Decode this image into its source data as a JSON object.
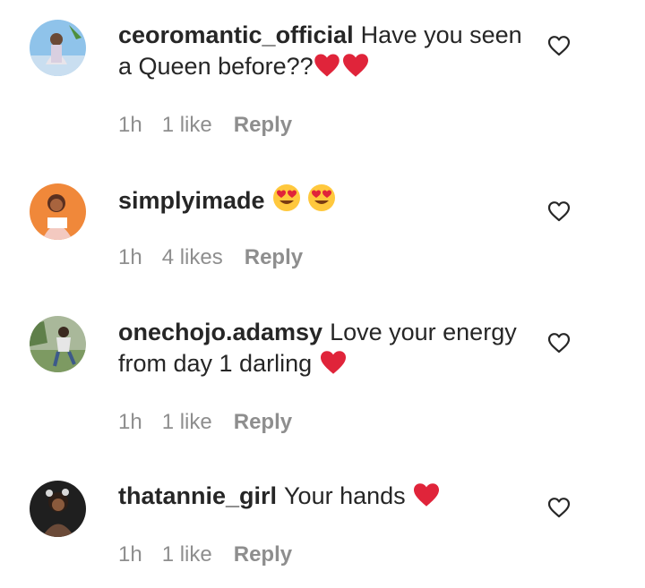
{
  "comments": [
    {
      "username": "ceoromantic_official",
      "text": "Have you seen a Queen before??",
      "emojis": [
        "red-heart",
        "red-heart"
      ],
      "time": "1h",
      "likes": "1 like",
      "reply_label": "Reply"
    },
    {
      "username": "simplyimade",
      "text": "",
      "emojis": [
        "heart-eyes-face",
        "heart-eyes-face"
      ],
      "time": "1h",
      "likes": "4 likes",
      "reply_label": "Reply"
    },
    {
      "username": "onechojo.adamsy",
      "text": "Love your energy from day 1 darling",
      "emojis": [
        "red-heart"
      ],
      "time": "1h",
      "likes": "1 like",
      "reply_label": "Reply"
    },
    {
      "username": "thatannie_girl",
      "text": "Your hands",
      "emojis": [
        "red-heart"
      ],
      "time": "1h",
      "likes": "1 like",
      "reply_label": "Reply"
    }
  ],
  "colors": {
    "text": "#262626",
    "secondary": "#8e8e8e",
    "heart_emoji": "#e0243a"
  }
}
